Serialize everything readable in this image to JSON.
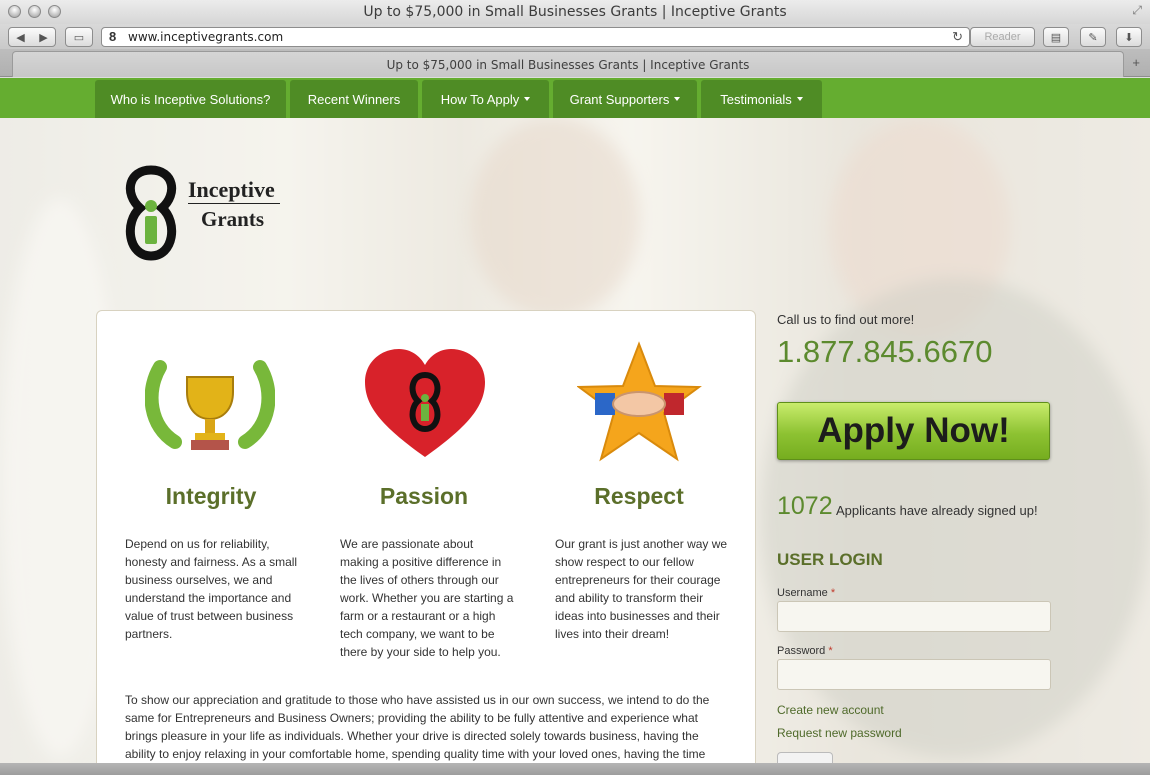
{
  "browser": {
    "window_title": "Up to $75,000 in Small Businesses Grants | Inceptive Grants",
    "url": "www.inceptivegrants.com",
    "reader_label": "Reader",
    "tab_title": "Up to $75,000 in Small Businesses Grants | Inceptive Grants",
    "icons": [
      "back-icon",
      "forward-icon",
      "bookmarks-icon",
      "reload-icon",
      "sidebar-icon",
      "css-icon",
      "download-icon",
      "new-tab-icon"
    ]
  },
  "nav": {
    "items": [
      {
        "label": "Who is Inceptive Solutions?"
      },
      {
        "label": "Recent Winners"
      },
      {
        "label": "How To Apply"
      },
      {
        "label": "Grant Supporters"
      },
      {
        "label": "Testimonials"
      }
    ]
  },
  "logo": {
    "line1": "Inceptive",
    "line2": "Grants"
  },
  "values": [
    {
      "title": "Integrity",
      "icon": "trophy-icon",
      "text": "Depend on us for reliability, honesty and fairness. As a small business ourselves, we and understand the importance and value of trust between business partners."
    },
    {
      "title": "Passion",
      "icon": "heart-icon",
      "text": "We are passionate about making a positive difference in the lives of others through our work. Whether you are starting a farm or a restaurant or a high tech company, we want to be there by your side to help you."
    },
    {
      "title": "Respect",
      "icon": "handshake-star-icon",
      "text": "Our grant is just another way we show respect to our fellow entrepreneurs for their courage and ability to transform their ideas into businesses and their lives into their dream!"
    }
  ],
  "appreciation": "To show our appreciation and gratitude to those who have assisted us in our own success, we intend to do the same for Entrepreneurs and Business Owners; providing the ability to be fully attentive and experience what brings pleasure in your life as individuals. Whether your drive is directed solely towards business, having the ability to enjoy relaxing in your comfortable home, spending quality time with your loved ones, having the time",
  "sidebar": {
    "call_us": "Call us to find out more!",
    "phone": "1.877.845.6670",
    "apply_label": "Apply Now!",
    "signup_count": "1072",
    "signup_text": "Applicants have already signed up!",
    "login_heading": "USER LOGIN",
    "username_label": "Username",
    "password_label": "Password",
    "required_mark": "*",
    "create_account": "Create new account",
    "request_password": "Request new password"
  },
  "colors": {
    "nav_green": "#65ad30",
    "nav_item": "#4f8c25",
    "accent_green": "#5c8a2e",
    "title_olive": "#5b6f2a"
  }
}
